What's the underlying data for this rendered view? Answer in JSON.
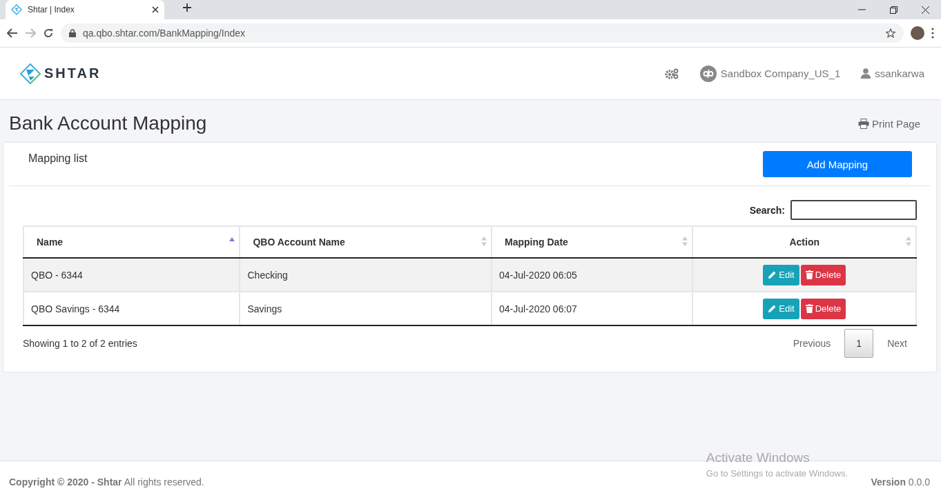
{
  "browser": {
    "tab_title": "Shtar | Index",
    "url": "qa.qbo.shtar.com/BankMapping/Index"
  },
  "header": {
    "logo_text": "SHTAR",
    "company": "Sandbox Company_US_1",
    "user": "ssankarwa"
  },
  "page": {
    "title": "Bank Account Mapping",
    "print_link": "Print Page"
  },
  "card": {
    "title": "Mapping list",
    "add_button": "Add Mapping",
    "search_label": "Search:"
  },
  "table": {
    "columns": [
      {
        "label": "Name",
        "sorted": true
      },
      {
        "label": "QBO Account Name",
        "sorted": false
      },
      {
        "label": "Mapping Date",
        "sorted": false
      },
      {
        "label": "Action",
        "sorted": false
      }
    ],
    "rows": [
      {
        "name": "QBO - 6344",
        "account": "Checking",
        "date": "04-Jul-2020 06:05",
        "edit": "Edit",
        "delete": "Delete"
      },
      {
        "name": "QBO Savings - 6344",
        "account": "Savings",
        "date": "04-Jul-2020 06:07",
        "edit": "Edit",
        "delete": "Delete"
      }
    ]
  },
  "info": "Showing 1 to 2 of 2 entries",
  "pagination": {
    "previous": "Previous",
    "pages": [
      {
        "label": "1",
        "selected": true
      }
    ],
    "next": "Next"
  },
  "footer": {
    "copyright_bold": "Copyright © 2020 - Shtar",
    "copyright_rest": "All rights reserved.",
    "version_label": "Version",
    "version": "0.0.0"
  },
  "os_notice": {
    "title": "Activate Windows",
    "text": "Go to Settings to activate Windows."
  }
}
